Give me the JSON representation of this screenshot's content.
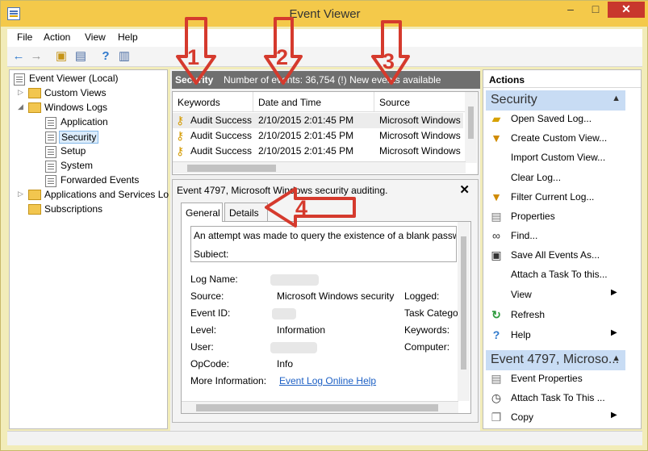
{
  "window": {
    "title": "Event Viewer",
    "min_label": "–",
    "max_label": "□",
    "close_label": "✕"
  },
  "menu": {
    "items": [
      "File",
      "Action",
      "View",
      "Help"
    ]
  },
  "toolbar": {
    "icons": [
      "back-icon",
      "forward-icon",
      "up-folder-icon",
      "show-hide-tree-icon",
      "help-icon",
      "show-action-pane-icon"
    ]
  },
  "tree": [
    {
      "label": "Event Viewer (Local)",
      "level": 0,
      "type": "root",
      "twisty": ""
    },
    {
      "label": "Custom Views",
      "level": 1,
      "type": "folder",
      "twisty": "▷"
    },
    {
      "label": "Windows Logs",
      "level": 1,
      "type": "folder",
      "twisty": "◢"
    },
    {
      "label": "Application",
      "level": 2,
      "type": "log",
      "twisty": ""
    },
    {
      "label": "Security",
      "level": 2,
      "type": "log",
      "twisty": "",
      "selected": true
    },
    {
      "label": "Setup",
      "level": 2,
      "type": "log",
      "twisty": ""
    },
    {
      "label": "System",
      "level": 2,
      "type": "log",
      "twisty": ""
    },
    {
      "label": "Forwarded Events",
      "level": 2,
      "type": "log",
      "twisty": ""
    },
    {
      "label": "Applications and Services Lo",
      "level": 1,
      "type": "folder",
      "twisty": "▷"
    },
    {
      "label": "Subscriptions",
      "level": 1,
      "type": "folder",
      "twisty": ""
    }
  ],
  "security_header": {
    "title": "Security",
    "info": "Number of events: 36,754 (!) New events available"
  },
  "event_list": {
    "columns": [
      "Keywords",
      "Date and Time",
      "Source"
    ],
    "rows": [
      {
        "keywords": "Audit Success",
        "date": "2/10/2015 2:01:45 PM",
        "source": "Microsoft Windows"
      },
      {
        "keywords": "Audit Success",
        "date": "2/10/2015 2:01:45 PM",
        "source": "Microsoft Windows"
      },
      {
        "keywords": "Audit Success",
        "date": "2/10/2015 2:01:45 PM",
        "source": "Microsoft Windows"
      }
    ]
  },
  "details": {
    "title": "Event 4797, Microsoft Windows security auditing.",
    "close_label": "✕",
    "tabs": [
      "General",
      "Details"
    ],
    "description_lines": [
      "An attempt was made to query the existence of a blank passw",
      "Subiect:"
    ],
    "fields": {
      "log_name_label": "Log Name:",
      "source_label": "Source:",
      "source_value": "Microsoft Windows security",
      "logged_label": "Logged:",
      "event_id_label": "Event ID:",
      "task_category_label": "Task Catego",
      "level_label": "Level:",
      "level_value": "Information",
      "keywords_label": "Keywords:",
      "user_label": "User:",
      "computer_label": "Computer:",
      "opcode_label": "OpCode:",
      "opcode_value": "Info",
      "more_info_label": "More Information:",
      "more_info_link": "Event Log Online Help"
    }
  },
  "actions": {
    "header": "Actions",
    "groups": [
      {
        "title": "Security",
        "items": [
          {
            "label": "Open Saved Log...",
            "icon": "folder-open-icon",
            "submenu": false
          },
          {
            "label": "Create Custom View...",
            "icon": "filter-icon",
            "submenu": false
          },
          {
            "label": "Import Custom View...",
            "icon": "",
            "submenu": false
          },
          {
            "label": "Clear Log...",
            "icon": "",
            "submenu": false
          },
          {
            "label": "Filter Current Log...",
            "icon": "filter-icon",
            "submenu": false
          },
          {
            "label": "Properties",
            "icon": "properties-icon",
            "submenu": false
          },
          {
            "label": "Find...",
            "icon": "binoculars-icon",
            "submenu": false
          },
          {
            "label": "Save All Events As...",
            "icon": "save-icon",
            "submenu": false
          },
          {
            "label": "Attach a Task To this...",
            "icon": "",
            "submenu": false
          },
          {
            "label": "View",
            "icon": "",
            "submenu": true
          },
          {
            "label": "Refresh",
            "icon": "refresh-icon",
            "submenu": false
          },
          {
            "label": "Help",
            "icon": "help-icon",
            "submenu": true
          }
        ]
      },
      {
        "title": "Event 4797, Microso...",
        "items": [
          {
            "label": "Event Properties",
            "icon": "properties-icon",
            "submenu": false
          },
          {
            "label": "Attach Task To This ...",
            "icon": "clock-icon",
            "submenu": false
          },
          {
            "label": "Copy",
            "icon": "copy-icon",
            "submenu": true
          }
        ]
      }
    ]
  },
  "annotations": [
    "1",
    "2",
    "3",
    "4"
  ],
  "colors": {
    "title_bar": "#f4c94a",
    "arrow": "#d53a2d",
    "selection": "#dcecfb",
    "group_header": "#c8dcf4"
  }
}
